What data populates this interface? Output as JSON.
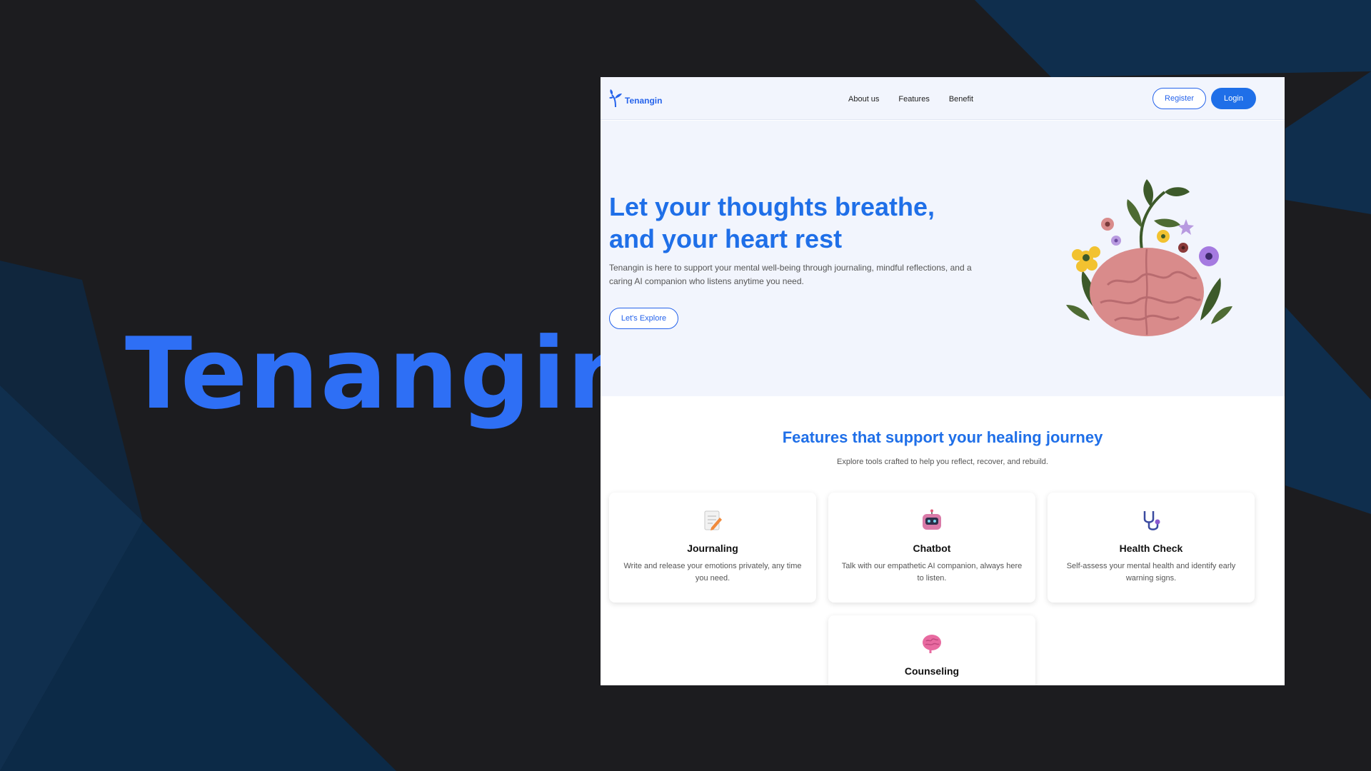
{
  "banner": {
    "title": "Tenangin"
  },
  "site": {
    "logo_text": "Tenangin",
    "nav": [
      "About us",
      "Features",
      "Benefit"
    ],
    "register_label": "Register",
    "login_label": "Login"
  },
  "hero": {
    "heading_line1": "Let your thoughts breathe,",
    "heading_line2": "and your heart rest",
    "description": "Tenangin is here to support your mental well-being through journaling, mindful reflections, and a caring AI companion who listens anytime you need.",
    "cta_label": "Let's Explore"
  },
  "features": {
    "title": "Features that support your healing journey",
    "subtitle": "Explore tools crafted to help you reflect, recover, and rebuild.",
    "cards": [
      {
        "title": "Journaling",
        "desc": "Write and release your emotions privately, any time you need.",
        "icon": "notepad-icon"
      },
      {
        "title": "Chatbot",
        "desc": "Talk with our empathetic AI companion, always here to listen.",
        "icon": "robot-icon"
      },
      {
        "title": "Health Check",
        "desc": "Self-assess your mental health and identify early warning signs.",
        "icon": "stethoscope-icon"
      },
      {
        "title": "Counseling",
        "desc": "",
        "icon": "brain-icon"
      }
    ]
  },
  "colors": {
    "accent": "#1f6fe8",
    "banner_text": "#2e6ff5",
    "background": "#1c1c1f"
  }
}
